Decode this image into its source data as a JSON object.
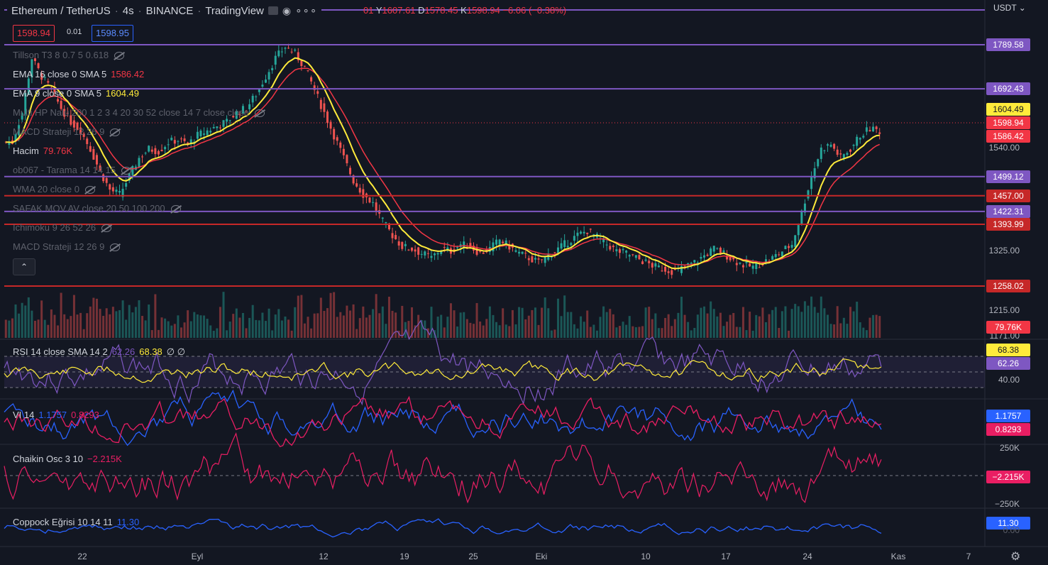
{
  "header": {
    "symbol": "Ethereum / TetherUS",
    "interval": "4s",
    "exchange": "BINANCE",
    "source": "TradingView",
    "ohlc_open_label": "01",
    "ohlc_high_label": "Y",
    "ohlc_high": "1607.61",
    "ohlc_low_label": "D",
    "ohlc_low": "1578.45",
    "ohlc_close_label": "K",
    "ohlc_close": "1598.94",
    "ohlc_change": "−6.06 (−0.38%)"
  },
  "quote": {
    "bid": "1598.94",
    "spread": "0.01",
    "ask": "1598.95"
  },
  "currency": "USDT",
  "indicators": [
    {
      "name": "Tillson T3 8 0.7 5 0.618",
      "value": "",
      "hidden": true
    },
    {
      "name": "EMA 16 close 0 SMA 5",
      "value": "1586.42",
      "hidden": false,
      "color": "#f23645"
    },
    {
      "name": "EMA 9 close 0 SMA 5",
      "value": "1604.49",
      "hidden": false,
      "color": "#ffeb3b"
    },
    {
      "name": "Multi HP Nalu 200 1 2 3 4 20 30 52 close 14 7 close close",
      "value": "",
      "hidden": true
    },
    {
      "name": "MACD Strateji 12 26 9",
      "value": "",
      "hidden": true
    },
    {
      "name": "Hacim",
      "value": "79.76K",
      "hidden": false,
      "color": "#f23645"
    },
    {
      "name": "ob067 - Tarama 14 14 15",
      "value": "",
      "hidden": true
    },
    {
      "name": "WMA 20 close 0",
      "value": "",
      "hidden": true
    },
    {
      "name": "SAFAK MOV.AV close 20 50 100 200",
      "value": "",
      "hidden": true
    },
    {
      "name": "Ichimoku 9 26 52 26",
      "value": "",
      "hidden": true
    },
    {
      "name": "MACD Strateji 12 26 9",
      "value": "",
      "hidden": true
    }
  ],
  "price_axis": [
    "1540.00",
    "1325.00",
    "1215.00",
    "1171.00"
  ],
  "levels": [
    {
      "label": "1789.58",
      "price": 1789.58,
      "color": "#7e57c2",
      "text_color": "#ffffff"
    },
    {
      "label": "1692.43",
      "price": 1692.43,
      "color": "#7e57c2",
      "text_color": "#ffffff"
    },
    {
      "label": "1499.12",
      "price": 1499.12,
      "color": "#7e57c2",
      "text_color": "#ffffff"
    },
    {
      "label": "1457.00",
      "price": 1457.0,
      "color": "#c62828",
      "text_color": "#ffffff"
    },
    {
      "label": "1422.31",
      "price": 1422.31,
      "color": "#7e57c2",
      "text_color": "#ffffff"
    },
    {
      "label": "1393.99",
      "price": 1393.99,
      "color": "#c62828",
      "text_color": "#ffffff"
    },
    {
      "label": "1258.02",
      "price": 1258.02,
      "color": "#c62828",
      "text_color": "#ffffff"
    }
  ],
  "price_tags": {
    "ema9": "1604.49",
    "last": "1598.94",
    "ema16": "1586.42",
    "volume": "79.76K"
  },
  "rsi": {
    "name": "RSI 14 close SMA 14 2",
    "value": "62.26",
    "sma": "68.38",
    "extra": "∅ ∅",
    "axis": "40.00"
  },
  "vi": {
    "name": "VI 14",
    "plus": "1.1757",
    "minus": "0.8293"
  },
  "chaikin": {
    "name": "Chaikin Osc 3 10",
    "value": "−2.215K",
    "axis_top": "250K",
    "axis_bottom": "−250K"
  },
  "coppock": {
    "name": "Coppock Eğrisi 10 14 11",
    "value": "11.30",
    "axis": "0.00"
  },
  "time_axis": [
    {
      "label": "22"
    },
    {
      "label": "Eyl"
    },
    {
      "label": "12"
    },
    {
      "label": "19"
    },
    {
      "label": "25"
    },
    {
      "label": "Eki"
    },
    {
      "label": "10"
    },
    {
      "label": "17"
    },
    {
      "label": "24"
    },
    {
      "label": "Kas"
    },
    {
      "label": "7"
    }
  ],
  "colors": {
    "background": "#131722",
    "up": "#26a69a",
    "down": "#ef5350",
    "ema9": "#ffeb3b",
    "ema16": "#f23645",
    "level_purple": "#7e57c2",
    "level_red": "#c62828",
    "rsi": "#7e57c2",
    "vi_plus": "#2962ff",
    "vi_minus": "#e91e63",
    "chaikin": "#e91e63",
    "coppock": "#2962ff"
  },
  "chart_data": {
    "type": "candlestick",
    "closes": [
      1575,
      1640,
      1760,
      1720,
      1690,
      1650,
      1620,
      1600,
      1560,
      1510,
      1470,
      1460,
      1500,
      1540,
      1560,
      1555,
      1575,
      1580,
      1570,
      1590,
      1600,
      1610,
      1620,
      1640,
      1650,
      1680,
      1720,
      1760,
      1785,
      1770,
      1740,
      1690,
      1640,
      1590,
      1540,
      1490,
      1460,
      1440,
      1400,
      1370,
      1345,
      1340,
      1330,
      1320,
      1340,
      1335,
      1350,
      1345,
      1330,
      1340,
      1360,
      1345,
      1330,
      1320,
      1310,
      1325,
      1340,
      1355,
      1370,
      1380,
      1365,
      1350,
      1335,
      1330,
      1320,
      1310,
      1300,
      1295,
      1290,
      1300,
      1310,
      1325,
      1340,
      1330,
      1315,
      1305,
      1300,
      1310,
      1320,
      1335,
      1350,
      1420,
      1500,
      1560,
      1570,
      1540,
      1560,
      1590,
      1605,
      1600
    ],
    "volume_last": "79.76K"
  }
}
